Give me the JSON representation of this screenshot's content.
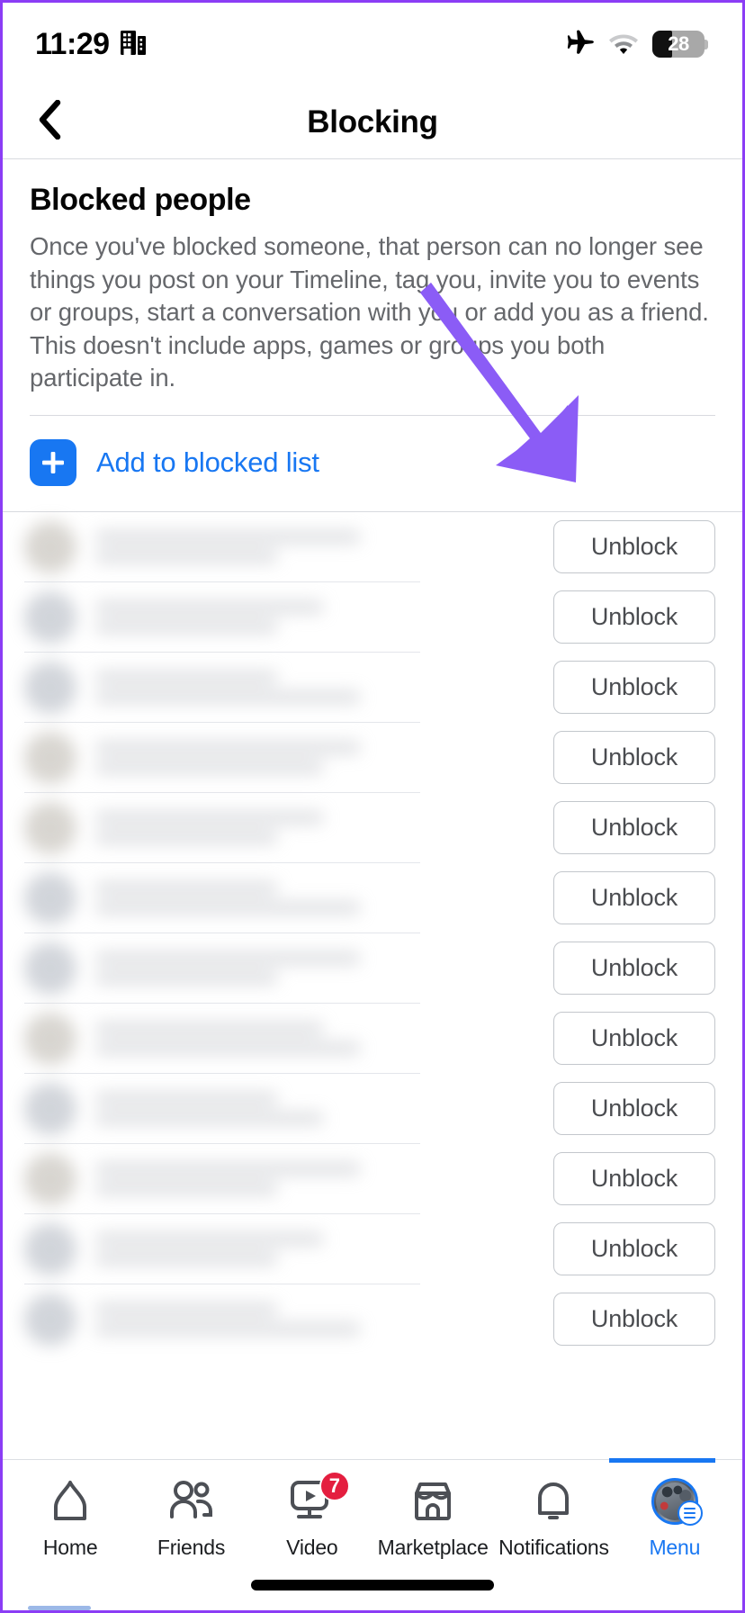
{
  "statusbar": {
    "time": "11:29",
    "building_icon": "building-icon",
    "airplane_icon": "airplane-mode-icon",
    "wifi_icon": "wifi-icon",
    "battery_percent": "28",
    "battery_icon": "battery-icon"
  },
  "header": {
    "back_icon": "back-chevron-icon",
    "title": "Blocking"
  },
  "main": {
    "section_title": "Blocked people",
    "description": "Once you've blocked someone, that person can no longer see things you post on your Timeline, tag you, invite you to events or groups, start a conversation with you or add you as a friend. This doesn't include apps, games or groups you both participate in.",
    "add_label": "Add to blocked list",
    "plus_icon": "plus-icon",
    "unblock_label": "Unblock",
    "rows": [
      {
        "unblock": "Unblock"
      },
      {
        "unblock": "Unblock"
      },
      {
        "unblock": "Unblock"
      },
      {
        "unblock": "Unblock"
      },
      {
        "unblock": "Unblock"
      },
      {
        "unblock": "Unblock"
      },
      {
        "unblock": "Unblock"
      },
      {
        "unblock": "Unblock"
      },
      {
        "unblock": "Unblock"
      },
      {
        "unblock": "Unblock"
      },
      {
        "unblock": "Unblock"
      },
      {
        "unblock": "Unblock"
      }
    ]
  },
  "annotation": {
    "arrow_color": "#8b5cf6",
    "arrow_name": "highlight-arrow"
  },
  "tabbar": {
    "items": [
      {
        "label": "Home",
        "icon": "home-icon",
        "active": false,
        "badge": ""
      },
      {
        "label": "Friends",
        "icon": "friends-icon",
        "active": false,
        "badge": ""
      },
      {
        "label": "Video",
        "icon": "video-icon",
        "active": false,
        "badge": "7"
      },
      {
        "label": "Marketplace",
        "icon": "marketplace-icon",
        "active": false,
        "badge": ""
      },
      {
        "label": "Notifications",
        "icon": "bell-icon",
        "active": false,
        "badge": ""
      },
      {
        "label": "Menu",
        "icon": "menu-avatar-icon",
        "active": true,
        "badge": ""
      }
    ]
  },
  "colors": {
    "accent_blue": "#1877f2",
    "arrow_purple": "#8b5cf6",
    "badge_red": "#e41e3f",
    "text_secondary": "#65676b"
  }
}
